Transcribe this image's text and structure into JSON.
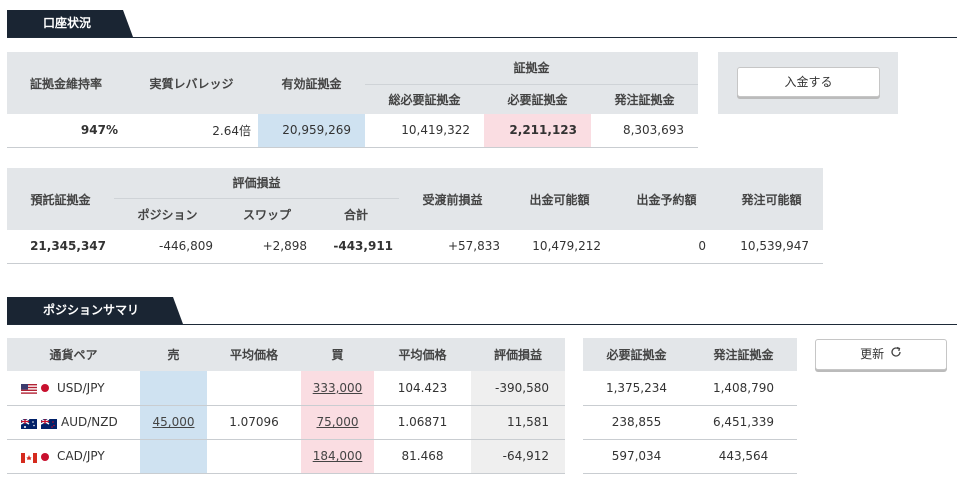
{
  "account": {
    "section_title": "口座状況",
    "table1": {
      "headers": {
        "maintenance_rate": "証拠金維持率",
        "leverage": "実質レバレッジ",
        "effective_margin": "有効証拠金",
        "margin_group": "証拠金",
        "total_required": "総必要証拠金",
        "required": "必要証拠金",
        "order_margin": "発注証拠金"
      },
      "values": {
        "maintenance_rate": "947%",
        "leverage": "2.64倍",
        "effective_margin": "20,959,269",
        "total_required": "10,419,322",
        "required": "2,211,123",
        "order_margin": "8,303,693"
      }
    },
    "deposit_button": "入金する",
    "table2": {
      "headers": {
        "deposit_margin": "預託証拠金",
        "valuation_group": "評価損益",
        "position": "ポジション",
        "swap": "スワップ",
        "total": "合計",
        "pre_delivery": "受渡前損益",
        "withdrawable": "出金可能額",
        "withdraw_reserved": "出金予約額",
        "orderable": "発注可能額"
      },
      "values": {
        "deposit_margin": "21,345,347",
        "position": "-446,809",
        "swap": "+2,898",
        "total": "-443,911",
        "pre_delivery": "+57,833",
        "withdrawable": "10,479,212",
        "withdraw_reserved": "0",
        "orderable": "10,539,947"
      }
    }
  },
  "positions": {
    "section_title": "ポジションサマリ",
    "headers": {
      "pair": "通貨ペア",
      "sell": "売",
      "avg_price_sell": "平均価格",
      "buy": "買",
      "avg_price_buy": "平均価格",
      "valuation": "評価損益",
      "required_margin": "必要証拠金",
      "order_margin": "発注証拠金"
    },
    "rows": [
      {
        "pair": "USD/JPY",
        "flag_icon": "us-flag-icon",
        "sell": "",
        "avg_sell": "",
        "buy": "333,000",
        "avg_buy": "104.423",
        "valuation": "-390,580",
        "required": "1,375,234",
        "order": "1,408,790"
      },
      {
        "pair": "AUD/NZD",
        "flag_icon": "au-flag-icon",
        "sell": "45,000",
        "avg_sell": "1.07096",
        "buy": "75,000",
        "avg_buy": "1.06871",
        "valuation": "11,581",
        "required": "238,855",
        "order": "6,451,339"
      },
      {
        "pair": "CAD/JPY",
        "flag_icon": "ca-flag-icon",
        "sell": "",
        "avg_sell": "",
        "buy": "184,000",
        "avg_buy": "81.468",
        "valuation": "-64,912",
        "required": "597,034",
        "order": "443,564"
      }
    ],
    "refresh_button": "更新",
    "refresh_icon": "refresh-icon"
  }
}
